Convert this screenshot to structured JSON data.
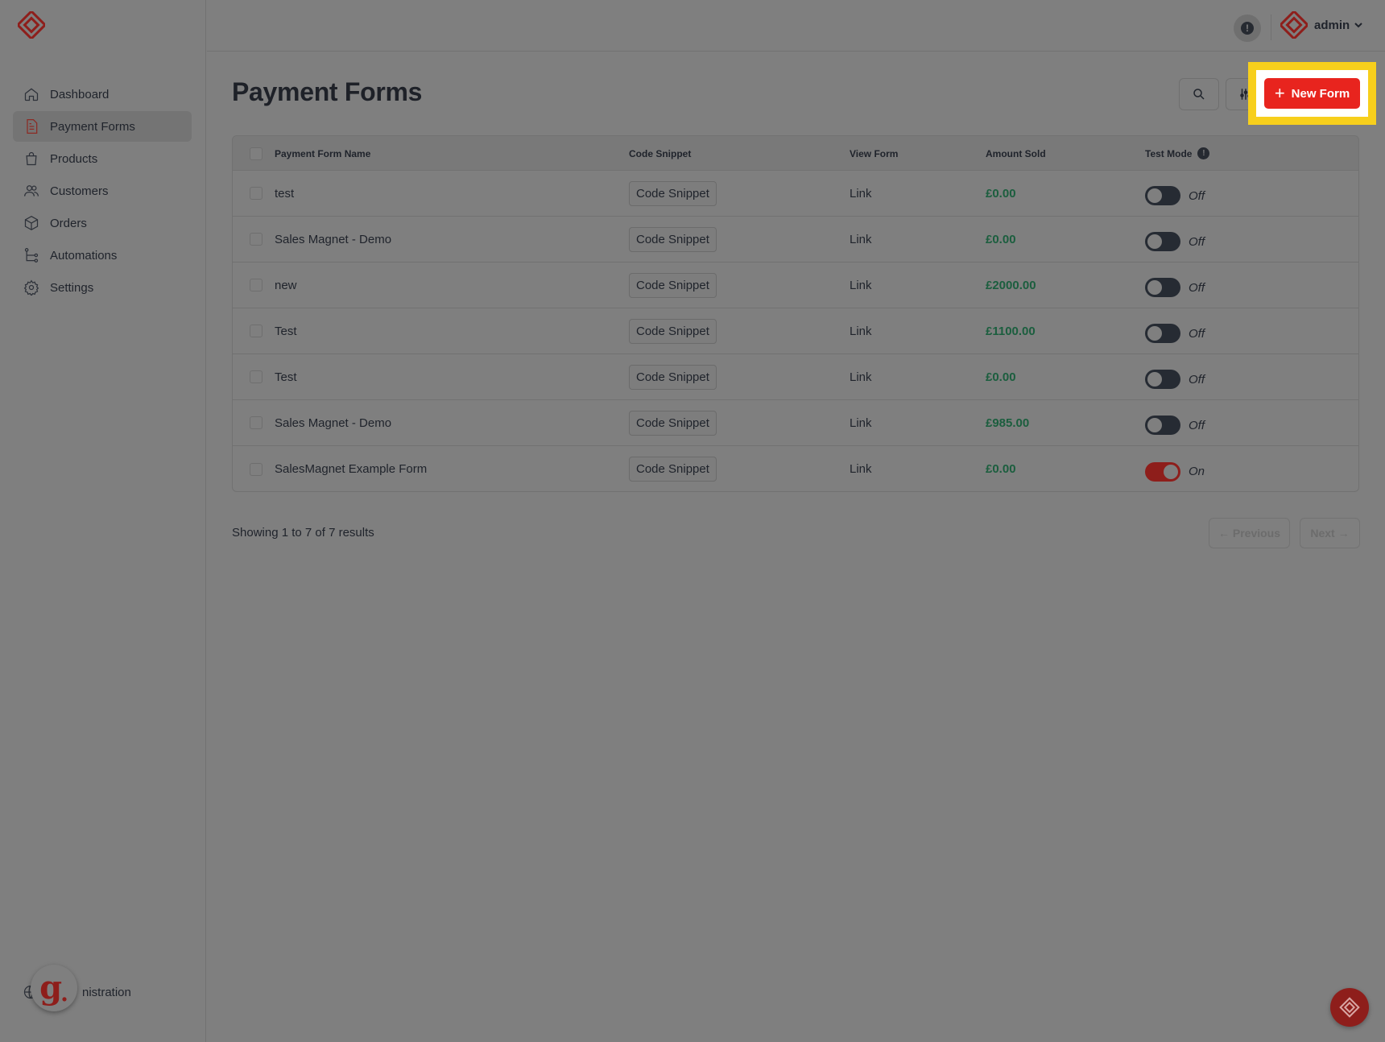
{
  "brand": {
    "accent": "#e8241e",
    "dim_accent": "#8e1e1b",
    "highlight": "#f7cf1c"
  },
  "sidebar": {
    "items": [
      {
        "label": "Dashboard",
        "icon": "home-icon",
        "active": false
      },
      {
        "label": "Payment Forms",
        "icon": "document-icon",
        "active": true
      },
      {
        "label": "Products",
        "icon": "shopping-bag-icon",
        "active": false
      },
      {
        "label": "Customers",
        "icon": "users-icon",
        "active": false
      },
      {
        "label": "Orders",
        "icon": "box-icon",
        "active": false
      },
      {
        "label": "Automations",
        "icon": "flow-icon",
        "active": false
      },
      {
        "label": "Settings",
        "icon": "gear-icon",
        "active": false
      }
    ],
    "admin_label": "nistration"
  },
  "topbar": {
    "user": "admin"
  },
  "page": {
    "title": "Payment Forms",
    "new_form_label": "New Form"
  },
  "table": {
    "headers": {
      "name": "Payment Form Name",
      "snippet": "Code Snippet",
      "view": "View Form",
      "amount": "Amount Sold",
      "test_mode": "Test Mode"
    },
    "rows": [
      {
        "name": "test",
        "snippet": "Code Snippet",
        "view": "Link",
        "amount": "£0.00",
        "test_mode": "Off"
      },
      {
        "name": "Sales Magnet - Demo",
        "snippet": "Code Snippet",
        "view": "Link",
        "amount": "£0.00",
        "test_mode": "Off"
      },
      {
        "name": "new",
        "snippet": "Code Snippet",
        "view": "Link",
        "amount": "£2000.00",
        "test_mode": "Off"
      },
      {
        "name": "Test",
        "snippet": "Code Snippet",
        "view": "Link",
        "amount": "£1100.00",
        "test_mode": "Off"
      },
      {
        "name": "Test",
        "snippet": "Code Snippet",
        "view": "Link",
        "amount": "£0.00",
        "test_mode": "Off"
      },
      {
        "name": "Sales Magnet - Demo",
        "snippet": "Code Snippet",
        "view": "Link",
        "amount": "£985.00",
        "test_mode": "Off"
      },
      {
        "name": "SalesMagnet Example Form",
        "snippet": "Code Snippet",
        "view": "Link",
        "amount": "£0.00",
        "test_mode": "On"
      }
    ]
  },
  "pagination": {
    "summary": "Showing 1 to 7 of 7 results",
    "previous": "← Previous",
    "next": "Next →"
  }
}
